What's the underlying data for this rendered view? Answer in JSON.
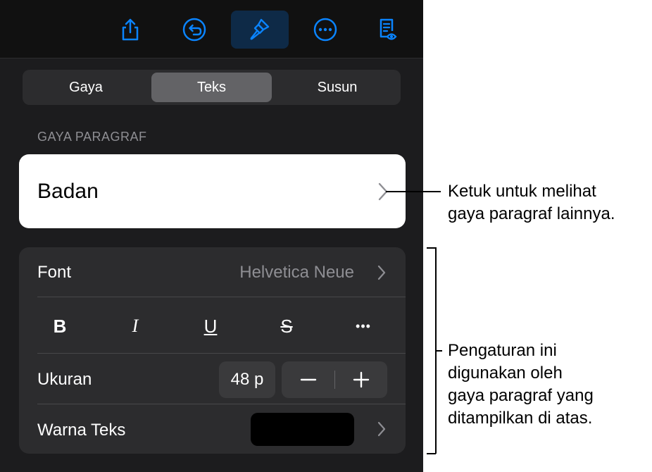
{
  "toolbar": {
    "buttons": [
      {
        "name": "share-icon"
      },
      {
        "name": "undo-icon"
      },
      {
        "name": "format-paintbrush-icon",
        "active": true
      },
      {
        "name": "more-icon"
      },
      {
        "name": "reading-view-icon"
      }
    ],
    "accent": "#0a84ff"
  },
  "tabs": [
    {
      "label": "Gaya",
      "selected": false
    },
    {
      "label": "Teks",
      "selected": true
    },
    {
      "label": "Susun",
      "selected": false
    }
  ],
  "paragraph_style": {
    "section_label": "GAYA PARAGRAF",
    "current": "Badan"
  },
  "font_row": {
    "label": "Font",
    "value": "Helvetica Neue"
  },
  "format_buttons": [
    {
      "name": "bold-button",
      "glyph": "B"
    },
    {
      "name": "italic-button",
      "glyph": "I"
    },
    {
      "name": "underline-button",
      "glyph": "U"
    },
    {
      "name": "strikethrough-button",
      "glyph": "S"
    },
    {
      "name": "more-format-button",
      "glyph": "•••"
    }
  ],
  "size_row": {
    "label": "Ukuran",
    "value": "48 p"
  },
  "color_row": {
    "label": "Warna Teks",
    "color": "#000000"
  },
  "callouts": {
    "top": [
      "Ketuk untuk melihat",
      "gaya paragraf lainnya."
    ],
    "bottom": [
      "Pengaturan ini",
      "digunakan oleh",
      "gaya paragraf yang",
      "ditampilkan di atas."
    ]
  }
}
